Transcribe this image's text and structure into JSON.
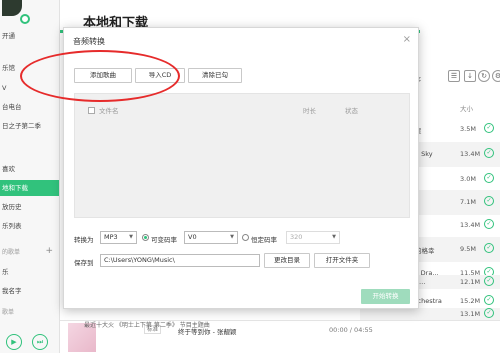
{
  "sidebar": {
    "vip_label": "开通",
    "items": [
      {
        "label": "乐馆"
      },
      {
        "label": "V"
      },
      {
        "label": "台电台"
      },
      {
        "label": "日之子第二季"
      },
      {
        "label": "喜欢"
      },
      {
        "label": "地和下载"
      },
      {
        "label": "放历史"
      },
      {
        "label": "乐列表"
      },
      {
        "label": "的歌单"
      },
      {
        "label": "乐"
      },
      {
        "label": "我名字"
      },
      {
        "label": "歌单"
      }
    ],
    "play_icon": "play-icon",
    "next_icon": "next-icon"
  },
  "main": {
    "title": "本地和下载",
    "sort_label": "排序",
    "size_header": "大小",
    "rows": [
      {
        "title": "星",
        "size": "3.5M"
      },
      {
        "title": "e Sky",
        "size": "13.4M"
      },
      {
        "title": "",
        "size": "3.0M"
      },
      {
        "title": "",
        "size": "7.1M"
      },
      {
        "title": "",
        "size": "13.4M"
      },
      {
        "title": "的格幸",
        "size": "9.5M"
      },
      {
        "title": "c Dra…",
        "size": "11.5M"
      },
      {
        "title": "e…",
        "size": "12.1M"
      },
      {
        "title": "rchestra",
        "size": "15.2M"
      },
      {
        "title": "",
        "size": "13.1M"
      }
    ]
  },
  "player": {
    "scroll_text": "最近十大火 《明士上下第 第二季》 节目主题曲",
    "tag_label": "标准",
    "now_playing": "终于等到你 - 张靓颖",
    "time": "00:00 / 04:55"
  },
  "dialog": {
    "title": "音频转换",
    "close": "×",
    "buttons": {
      "add_song": "添加歌曲",
      "import_cd": "导入CD",
      "clear_checked": "清除已勾"
    },
    "list_headers": {
      "filename": "文件名",
      "duration": "时长",
      "status": "状态"
    },
    "convert_label": "转换为",
    "format": "MP3",
    "vbr_label": "可变码率",
    "vbr_value": "V0",
    "cbr_label": "恒定码率",
    "cbr_value": "320",
    "save_label": "保存到",
    "save_path": "C:\\Users\\YONG\\Music\\",
    "change_dir": "更改目录",
    "open_folder": "打开文件夹",
    "start": "开始转换"
  }
}
